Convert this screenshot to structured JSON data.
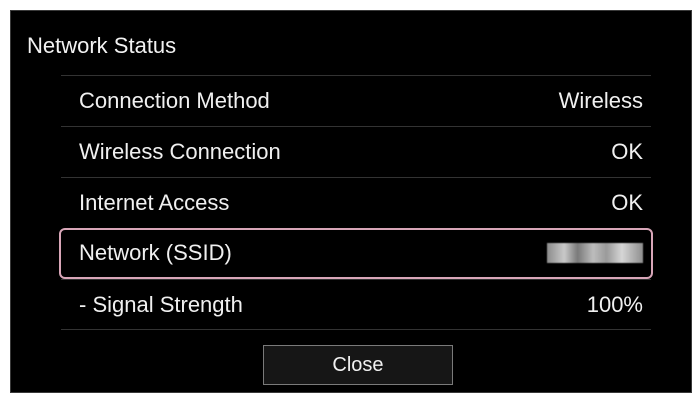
{
  "dialog": {
    "title": "Network Status",
    "rows": [
      {
        "label": "Connection Method",
        "value": "Wireless"
      },
      {
        "label": "Wireless Connection",
        "value": "OK"
      },
      {
        "label": "Internet Access",
        "value": "OK"
      },
      {
        "label": "Network (SSID)",
        "value": "",
        "redacted": true,
        "selected": true
      },
      {
        "label": "- Signal Strength",
        "value": "100%"
      }
    ],
    "close_label": "Close"
  },
  "colors": {
    "background": "#000000",
    "text": "#f0f0f0",
    "selection_border": "#d8a6b8",
    "divider": "#333333"
  }
}
